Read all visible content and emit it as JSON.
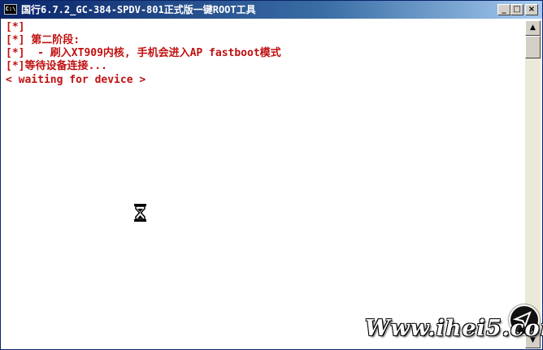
{
  "window": {
    "title": "国行6.7.2_GC-384-SPDV-801正式版一键ROOT工具",
    "system_icon_label": "C:\\",
    "minimize_glyph": "_",
    "maximize_glyph": "□",
    "close_glyph": "×"
  },
  "console": {
    "lines": [
      "[*]",
      "[*] 第二阶段:",
      "[*]  - 刷入XT909内核, 手机会进入AP fastboot模式",
      "[*]等待设备连接...",
      "< waiting for device >"
    ],
    "text_color": "#c01010",
    "background_color": "#ffffff"
  },
  "scrollbar": {
    "up_glyph": "▲",
    "down_glyph": "▼"
  },
  "watermark": {
    "text": "Www.ihei5.com"
  },
  "colors": {
    "titlebar_start": "#0a246a",
    "titlebar_end": "#a6caf0"
  }
}
